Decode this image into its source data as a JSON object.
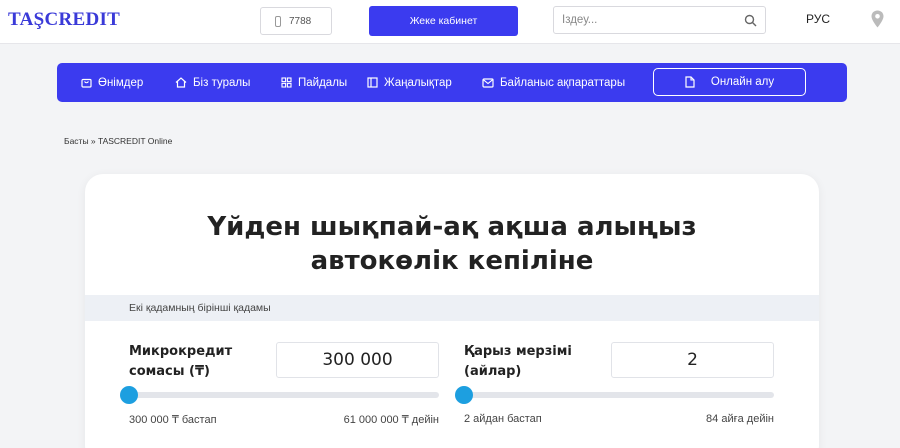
{
  "header": {
    "logo_text": "TAŞCREDIT",
    "phone": "7788",
    "cabinet_label": "Жеке кабинет",
    "search_placeholder": "Іздеу...",
    "language": "РУС"
  },
  "nav": {
    "items": [
      {
        "label": "Өнімдер",
        "icon": "bag-icon"
      },
      {
        "label": "Біз туралы",
        "icon": "home-icon"
      },
      {
        "label": "Пайдалы",
        "icon": "grid-icon"
      },
      {
        "label": "Жаңалықтар",
        "icon": "book-icon"
      },
      {
        "label": "Байланыс ақпараттары",
        "icon": "mail-icon"
      }
    ],
    "online_label": "Онлайн алу"
  },
  "breadcrumb": "Басты » TASCREDIT Online",
  "card": {
    "title_line1": "Үйден шықпай-ақ ақша алыңыз",
    "title_line2": "автокөлік кепіліне",
    "step_text": "Екі қадамның бірінші қадамы",
    "amount": {
      "label_line1": "Микрокредит",
      "label_line2": "сомасы (₸)",
      "value": "300 000",
      "min_label": "300 000 ₸ бастап",
      "max_label": "61 000 000 ₸ дейін",
      "slider_fraction": 0
    },
    "term": {
      "label_line1": "Қарыз мерзімі",
      "label_line2": "(айлар)",
      "value": "2",
      "min_label": "2 айдан бастап",
      "max_label": "84 айға дейін",
      "slider_fraction": 0
    }
  },
  "colors": {
    "brand": "#3b3bef",
    "knob": "#1d9fe0"
  }
}
